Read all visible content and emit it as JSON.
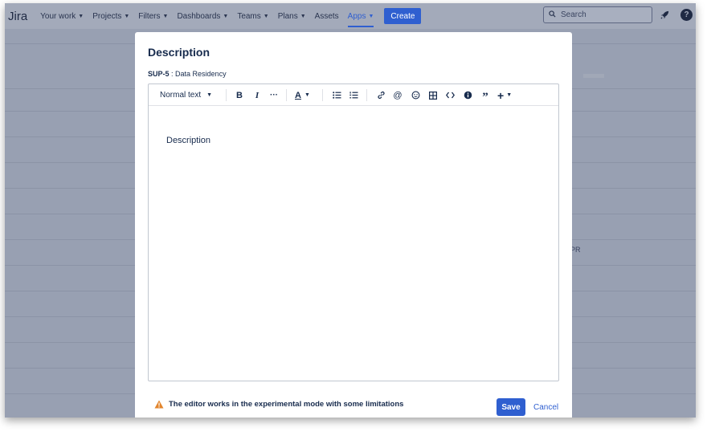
{
  "topbar": {
    "logo": "Jira",
    "nav": [
      {
        "label": "Your work",
        "chevron": true
      },
      {
        "label": "Projects",
        "chevron": true
      },
      {
        "label": "Filters",
        "chevron": true
      },
      {
        "label": "Dashboards",
        "chevron": true
      },
      {
        "label": "Teams",
        "chevron": true
      },
      {
        "label": "Plans",
        "chevron": true
      },
      {
        "label": "Assets",
        "chevron": false
      },
      {
        "label": "Apps",
        "chevron": true,
        "active": true
      }
    ],
    "create_label": "Create",
    "search_placeholder": "Search"
  },
  "background": {
    "partial_text": "PR"
  },
  "modal": {
    "title": "Description",
    "issue_key": "SUP-5",
    "issue_separator": " : ",
    "issue_title": "Data Residency",
    "toolbar": {
      "text_style": "Normal text"
    },
    "editor_content": "Description",
    "warning": "The editor works in the experimental mode with some limitations",
    "save_label": "Save",
    "cancel_label": "Cancel"
  },
  "colors": {
    "primary": "#2f5fd0",
    "text": "#172b4d",
    "warning": "#e2852d",
    "overlay": "#98a0b2"
  }
}
